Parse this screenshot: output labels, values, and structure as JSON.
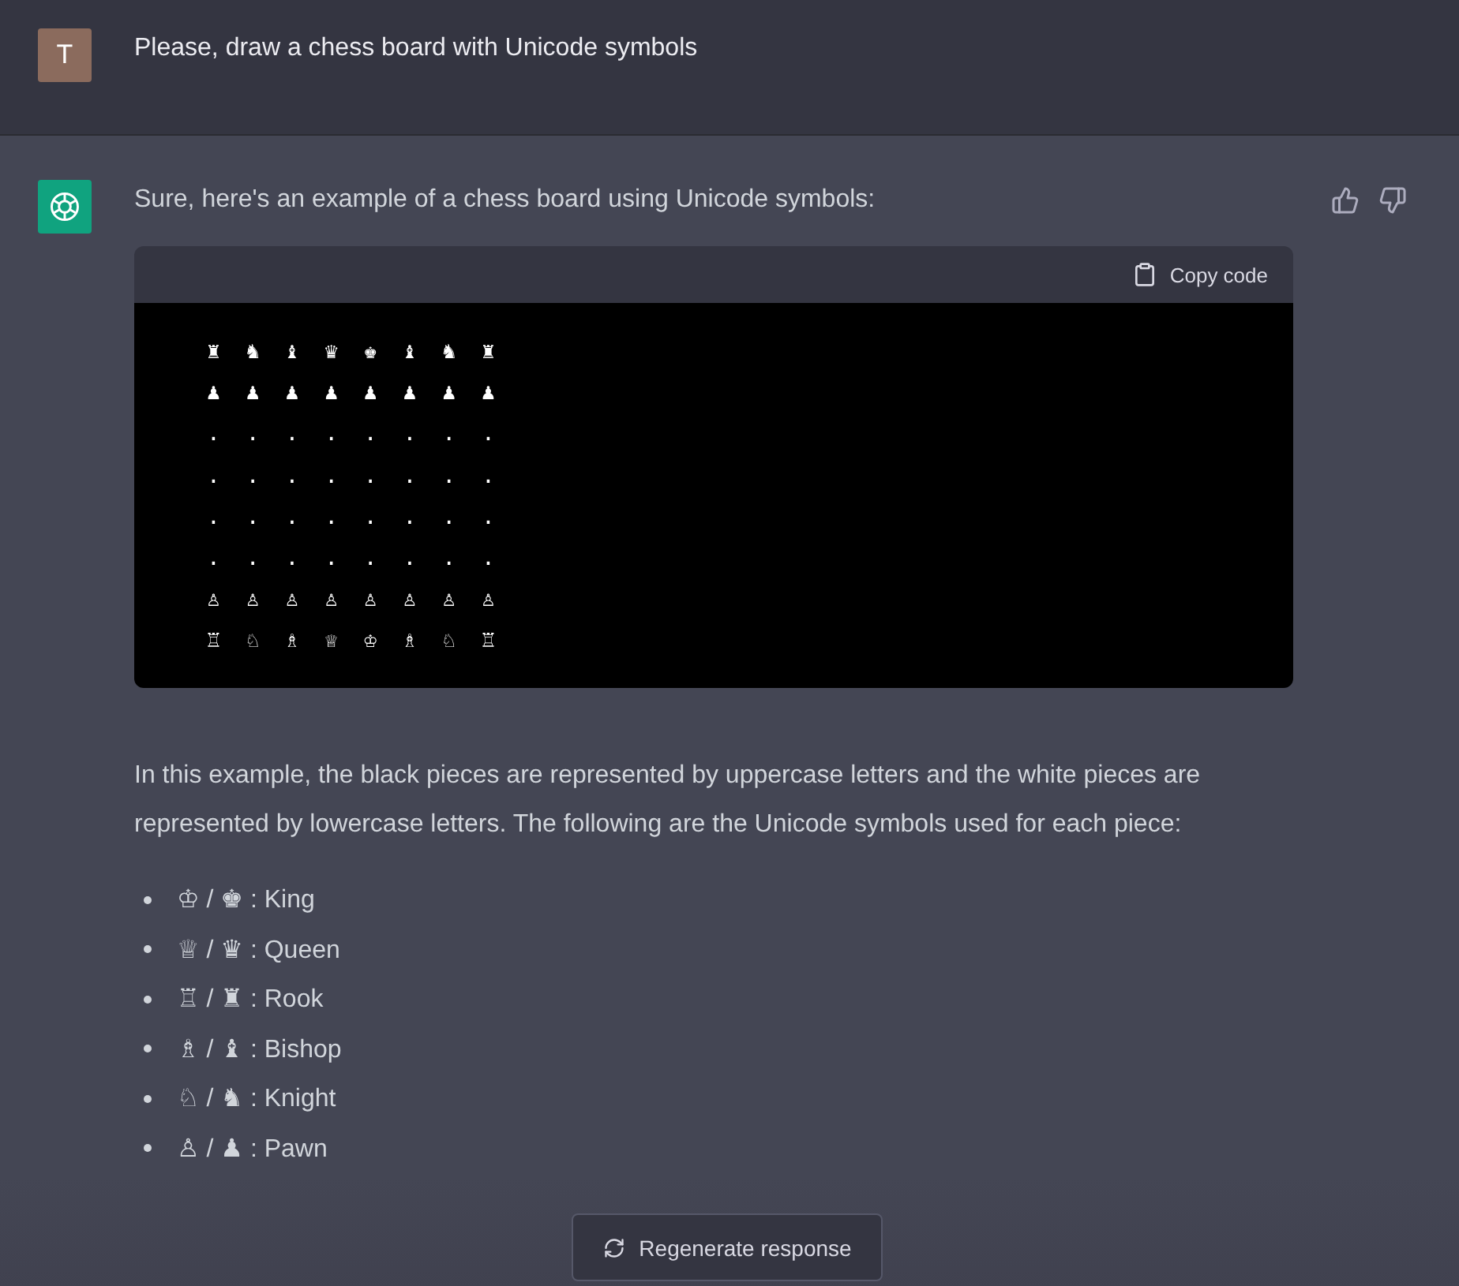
{
  "user_message": {
    "avatar": "T",
    "text": "Please, draw a chess board with Unicode symbols"
  },
  "assistant_message": {
    "intro": "Sure, here's an example of a chess board using Unicode symbols:",
    "code_block": {
      "copy_label": "Copy code",
      "lines": [
        "♜ ♞ ♝ ♛ ♚ ♝ ♞ ♜",
        "♟ ♟ ♟ ♟ ♟ ♟ ♟ ♟",
        ". . . . . . . .",
        ". . . . . . . .",
        ". . . . . . . .",
        ". . . . . . . .",
        "♙ ♙ ♙ ♙ ♙ ♙ ♙ ♙",
        "♖ ♘ ♗ ♕ ♔ ♗ ♘ ♖"
      ]
    },
    "paragraph": "In this example, the black pieces are represented by uppercase letters and the white pieces are represented by lowercase letters. The following are the Unicode symbols used for each piece:",
    "list": [
      "♔ / ♚ : King",
      "♕ / ♛ : Queen",
      "♖ / ♜ : Rook",
      "♗ / ♝ : Bishop",
      "♘ / ♞ : Knight",
      "♙ / ♟ : Pawn"
    ]
  },
  "regenerate_button": "Regenerate response"
}
